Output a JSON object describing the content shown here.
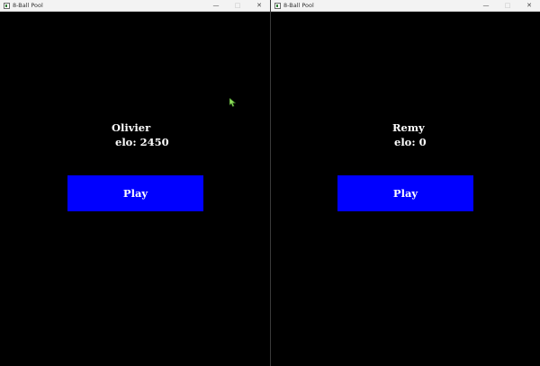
{
  "windows": [
    {
      "title": "8-Ball Pool",
      "player_name": "Olivier",
      "elo_text": "elo: 2450",
      "play_label": "Play"
    },
    {
      "title": "8-Ball Pool",
      "player_name": "Remy",
      "elo_text": "elo: 0",
      "play_label": "Play"
    }
  ],
  "controls": {
    "minimize": "—",
    "maximize": "□",
    "close": "✕"
  },
  "colors": {
    "background": "#000000",
    "play_button": "#0000ff",
    "text": "#ffffff"
  }
}
